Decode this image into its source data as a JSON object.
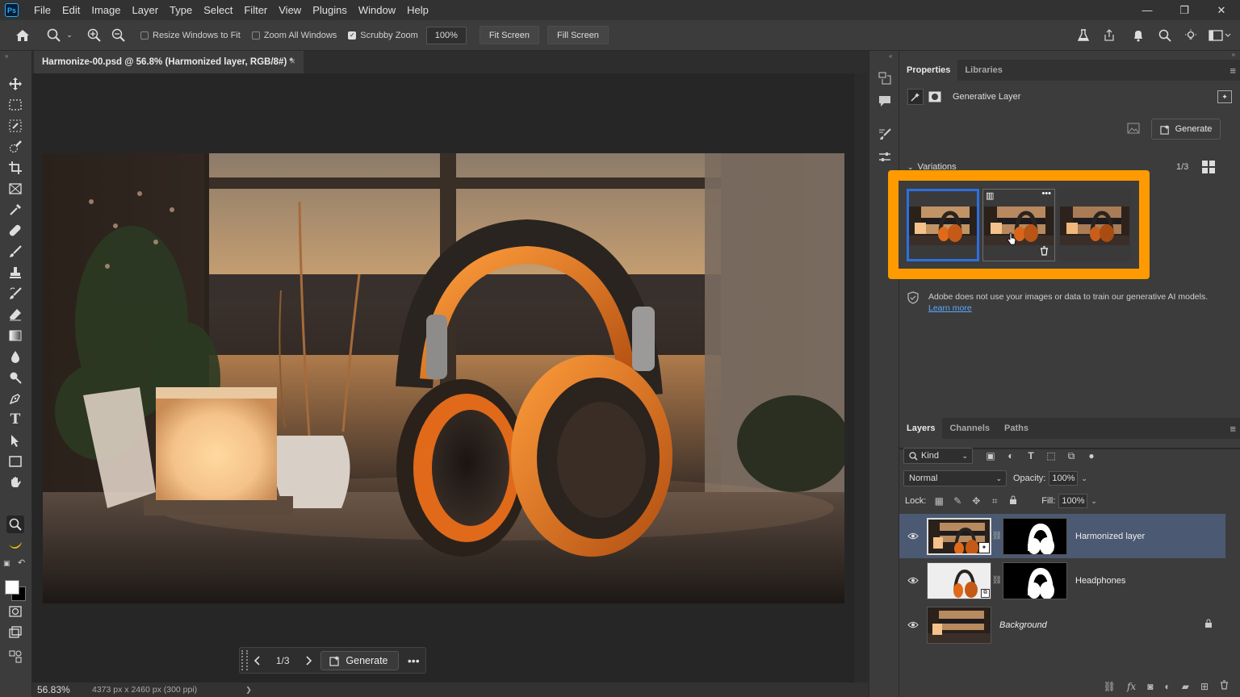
{
  "app": {
    "logo": "Ps"
  },
  "menu": [
    "File",
    "Edit",
    "Image",
    "Layer",
    "Type",
    "Select",
    "Filter",
    "View",
    "Plugins",
    "Window",
    "Help"
  ],
  "window_controls": {
    "minimize": "—",
    "restore": "❐",
    "close": "✕"
  },
  "options": {
    "resize_windows": "Resize Windows to Fit",
    "zoom_all": "Zoom All Windows",
    "scrubby_zoom": "Scrubby Zoom",
    "zoom_value": "100%",
    "fit_screen": "Fit Screen",
    "fill_screen": "Fill Screen"
  },
  "document": {
    "tab_title": "Harmonize-00.psd @ 56.8% (Harmonized layer, RGB/8#) *",
    "close": "×"
  },
  "taskbar": {
    "count": "1/3",
    "generate": "Generate",
    "more": "•••"
  },
  "status": {
    "zoom": "56.83%",
    "info": "4373 px x 2460 px (300 ppi)",
    "arrow": "❯"
  },
  "properties": {
    "tabs": [
      "Properties",
      "Libraries"
    ],
    "layer_type": "Generative Layer",
    "generate": "Generate",
    "variations_label": "Variations",
    "variations_count": "1/3",
    "privacy_text": "Adobe does not use your images or data to train our generative AI models.",
    "learn_more": "Learn more"
  },
  "layers_panel": {
    "tabs": [
      "Layers",
      "Channels",
      "Paths"
    ],
    "kind": "Kind",
    "blend_mode": "Normal",
    "opacity_label": "Opacity:",
    "opacity": "100%",
    "lock_label": "Lock:",
    "fill_label": "Fill:",
    "fill": "100%",
    "layers": [
      {
        "name": "Harmonized layer",
        "selected": true
      },
      {
        "name": "Headphones",
        "selected": false
      },
      {
        "name": "Background",
        "selected": false,
        "locked": true
      }
    ]
  },
  "colors": {
    "accent_orange": "#ff9a00",
    "selection_blue": "#2d6fdf",
    "layer_selected": "#4b5a72"
  }
}
